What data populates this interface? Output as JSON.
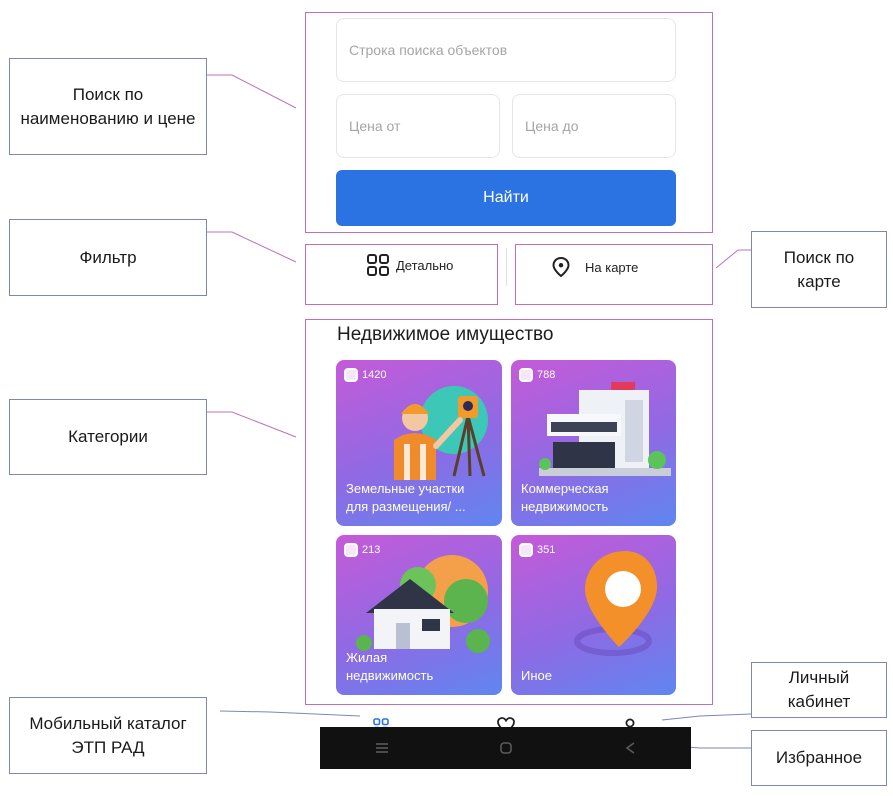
{
  "search": {
    "query_placeholder": "Строка поиска объектов",
    "price_from_placeholder": "Цена от",
    "price_to_placeholder": "Цена до",
    "find_button": "Найти"
  },
  "filters": {
    "detailed_label": "Детально",
    "map_label": "На карте"
  },
  "section_title": "Недвижимое имущество",
  "categories": [
    {
      "count": "1420",
      "label_line1": "Земельные участки",
      "label_line2": "для размещения/ ..."
    },
    {
      "count": "788",
      "label_line1": "Коммерческая",
      "label_line2": "недвижимость"
    },
    {
      "count": "213",
      "label_line1": "Жилая",
      "label_line2": "недвижимость"
    },
    {
      "count": "351",
      "label_line1": "Иное",
      "label_line2": ""
    }
  ],
  "annotations": {
    "search_by_name_price": "Поиск по наименованию и цене",
    "filter": "Фильтр",
    "search_by_map": "Поиск по карте",
    "categories": "Категории",
    "personal_account": "Личный кабинет",
    "mobile_catalog": "Мобильный каталог ЭТП РАД",
    "favorites": "Избранное"
  },
  "icons": {
    "grid": "grid-icon",
    "pin": "map-pin-icon",
    "heart": "heart-icon",
    "user": "user-icon",
    "catalog": "catalog-grid-icon"
  },
  "colors": {
    "primary": "#2b73e3",
    "frame": "#c070b8",
    "tile_from": "#c55ad8",
    "tile_to": "#5f86f0"
  }
}
